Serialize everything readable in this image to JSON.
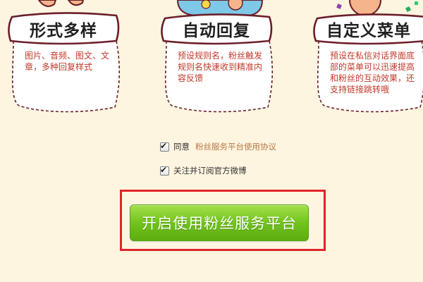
{
  "features": [
    {
      "title": "形式多样",
      "description": "图片、音频、图文、文章，多种回复样式"
    },
    {
      "title": "自动回复",
      "description": "预设规则名，粉丝触发规则名快速收到精准内容反馈"
    },
    {
      "title": "自定义菜单",
      "description": "预设在私信对话界面底部的菜单可以迅速提高和粉丝的互动效果，还支持链接跳转哦"
    }
  ],
  "agreements": {
    "agree_label": "同意",
    "agree_link": "粉丝服务平台使用协议",
    "follow_label": "关注并订阅官方微博"
  },
  "cta": {
    "start_label": "开启使用粉丝服务平台"
  },
  "colors": {
    "page_background": "#fdf5e0",
    "card_border": "#6b1f2a",
    "description_text": "#c0392b",
    "link_text": "#b97a48",
    "button_green": "#72c31d",
    "highlight_red": "#e0252b"
  }
}
